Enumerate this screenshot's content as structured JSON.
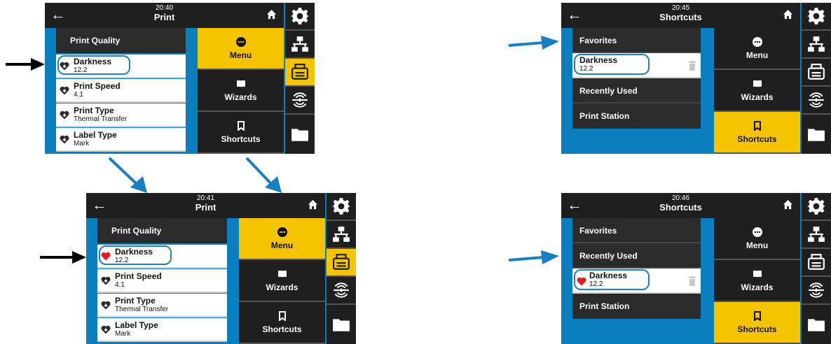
{
  "print_screen": {
    "time": "20:40",
    "title": "Print",
    "list_header": "Print Quality",
    "items": [
      {
        "name": "Darkness",
        "value": "12.2"
      },
      {
        "name": "Print Speed",
        "value": "4.1"
      },
      {
        "name": "Print Type",
        "value": "Thermal Transfer"
      },
      {
        "name": "Label Type",
        "value": "Mark"
      }
    ]
  },
  "print_screen_2": {
    "time": "20:41",
    "title": "Print"
  },
  "menu_buttons": {
    "menu": "Menu",
    "wizards": "Wizards",
    "shortcuts": "Shortcuts"
  },
  "shortcuts_screen_1": {
    "time": "20:45",
    "title": "Shortcuts",
    "items": [
      "Favorites",
      "Darkness",
      "Recently Used",
      "Print Station"
    ],
    "darkness_value": "12.2"
  },
  "shortcuts_screen_2": {
    "time": "20:46",
    "title": "Shortcuts",
    "items": [
      "Favorites",
      "Recently Used",
      "Darkness",
      "Print Station"
    ],
    "darkness_value": "12.2"
  },
  "side_icons": [
    "gear-icon",
    "network-icon",
    "printer-icon",
    "sensor-icon",
    "folder-icon"
  ],
  "colors": {
    "accent": "#f5c400",
    "panel": "#1f1f1f",
    "screen_bg": "#0b7fbd",
    "arrow_blue": "#1a7ec2",
    "heart_red": "#e02020"
  }
}
